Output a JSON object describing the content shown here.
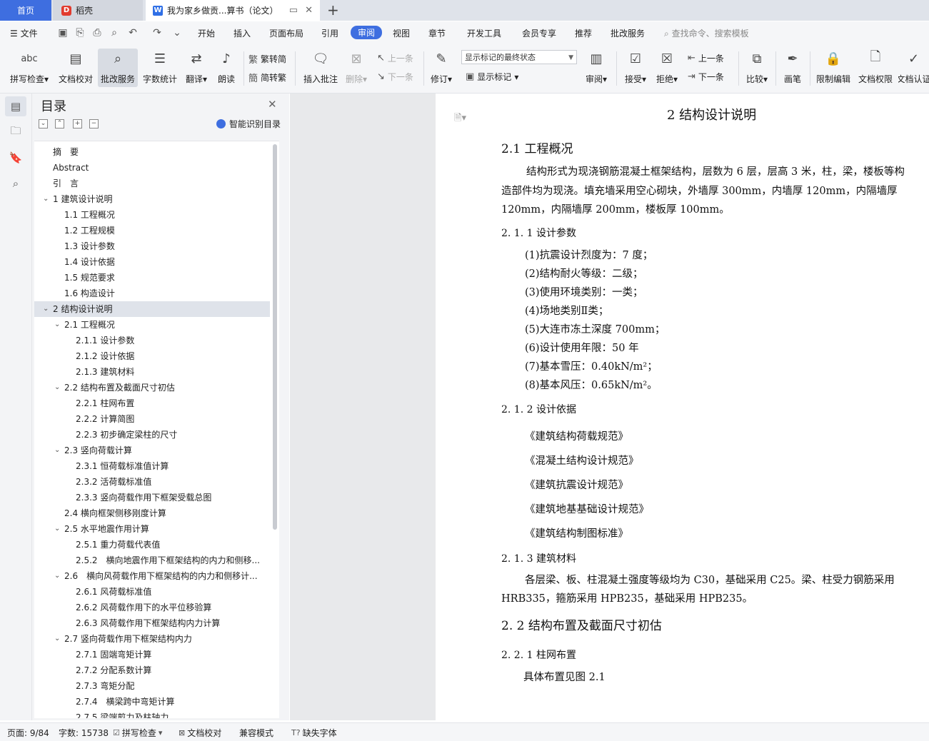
{
  "tabs": {
    "home": "首页",
    "daoke": "稻壳",
    "doc": "我为家乡做贡...算书（论文）"
  },
  "menu": {
    "file": "文件",
    "items": [
      "开始",
      "插入",
      "页面布局",
      "引用",
      "审阅",
      "视图",
      "章节",
      "开发工具",
      "会员专享",
      "推荐",
      "批改服务"
    ],
    "active": "审阅",
    "search": "查找命令、搜索模板"
  },
  "ribbon": {
    "spell": "拼写检查",
    "proofread": "文档校对",
    "correct": "批改服务",
    "wordcount": "字数统计",
    "translate": "翻译",
    "read": "朗读",
    "trad": "繁转简",
    "simp": "简转繁",
    "insert_comment": "插入批注",
    "delete": "删除",
    "prev": "上一条",
    "next": "下一条",
    "revise": "修订",
    "markup_state": "显示标记的最终状态",
    "show_markup": "显示标记",
    "review": "审阅",
    "accept": "接受",
    "reject": "拒绝",
    "prev2": "上一条",
    "next2": "下一条",
    "compare": "比较",
    "pen": "画笔",
    "restrict": "限制编辑",
    "permission": "文档权限",
    "cert": "文档认证"
  },
  "toc": {
    "title": "目录",
    "smart": "智能识别目录",
    "items": [
      {
        "label": "摘　要",
        "level": 0,
        "chev": false
      },
      {
        "label": "Abstract",
        "level": 0,
        "chev": false
      },
      {
        "label": "引　言",
        "level": 0,
        "chev": false
      },
      {
        "label": "1  建筑设计说明",
        "level": 0,
        "chev": true
      },
      {
        "label": "1.1  工程概况",
        "level": 1,
        "chev": false
      },
      {
        "label": "1.2  工程规模",
        "level": 1,
        "chev": false
      },
      {
        "label": "1.3  设计参数",
        "level": 1,
        "chev": false
      },
      {
        "label": "1.4  设计依据",
        "level": 1,
        "chev": false
      },
      {
        "label": "1.5  规范要求",
        "level": 1,
        "chev": false
      },
      {
        "label": "1.6  构造设计",
        "level": 1,
        "chev": false
      },
      {
        "label": "2  结构设计说明",
        "level": 0,
        "chev": true,
        "selected": true
      },
      {
        "label": "2.1  工程概况",
        "level": 1,
        "chev": true
      },
      {
        "label": "2.1.1 设计参数",
        "level": 2,
        "chev": false
      },
      {
        "label": "2.1.2  设计依据",
        "level": 2,
        "chev": false
      },
      {
        "label": "2.1.3  建筑材料",
        "level": 2,
        "chev": false
      },
      {
        "label": "2.2  结构布置及截面尺寸初估",
        "level": 1,
        "chev": true
      },
      {
        "label": "2.2.1  柱网布置",
        "level": 2,
        "chev": false
      },
      {
        "label": "2.2.2  计算简图",
        "level": 2,
        "chev": false
      },
      {
        "label": "2.2.3  初步确定梁柱的尺寸",
        "level": 2,
        "chev": false
      },
      {
        "label": "2.3  竖向荷载计算",
        "level": 1,
        "chev": true
      },
      {
        "label": "2.3.1  恒荷载标准值计算",
        "level": 2,
        "chev": false
      },
      {
        "label": "2.3.2  活荷载标准值",
        "level": 2,
        "chev": false
      },
      {
        "label": "2.3.3  竖向荷载作用下框架受载总图",
        "level": 2,
        "chev": false
      },
      {
        "label": "2.4  横向框架侧移刚度计算",
        "level": 1,
        "chev": false
      },
      {
        "label": "2.5  水平地震作用计算",
        "level": 1,
        "chev": true
      },
      {
        "label": "2.5.1  重力荷载代表值",
        "level": 2,
        "chev": false
      },
      {
        "label": "2.5.2　横向地震作用下框架结构的内力和侧移...",
        "level": 2,
        "chev": false
      },
      {
        "label": "2.6　横向风荷载作用下框架结构的内力和侧移计...",
        "level": 1,
        "chev": true
      },
      {
        "label": "2.6.1 风荷载标准值",
        "level": 2,
        "chev": false
      },
      {
        "label": "2.6.2  风荷载作用下的水平位移验算",
        "level": 2,
        "chev": false
      },
      {
        "label": "2.6.3 风荷载作用下框架结构内力计算",
        "level": 2,
        "chev": false
      },
      {
        "label": "2.7  竖向荷载作用下框架结构内力",
        "level": 1,
        "chev": true
      },
      {
        "label": "2.7.1  固端弯矩计算",
        "level": 2,
        "chev": false
      },
      {
        "label": "2.7.2  分配系数计算",
        "level": 2,
        "chev": false
      },
      {
        "label": "2.7.3  弯矩分配",
        "level": 2,
        "chev": false
      },
      {
        "label": "2.7.4　横梁跨中弯矩计算",
        "level": 2,
        "chev": false
      },
      {
        "label": "2.7.5  梁端剪力及柱轴力",
        "level": 2,
        "chev": false
      }
    ]
  },
  "doc": {
    "h1": "2  结构设计说明",
    "h2_1": "2.1  工程概况",
    "p1a": "结构形式为现浇钢筋混凝土框架结构，层数为 6 层，层高 3 米，柱，梁，楼板等构",
    "p1b": "造部件均为现浇。填充墙采用空心砌块，外墙厚 300mm，内墙厚 120mm，内隔墙厚",
    "p1c": "120mm，内隔墙厚 200mm，楼板厚 100mm。",
    "h3_1": "2. 1. 1 设计参数",
    "params": [
      "(1)抗震设计烈度为：7 度；",
      "(2)结构耐火等级：二级；",
      "(3)使用环境类别：一类；",
      "(4)场地类别Ⅱ类；",
      "(5)大连市冻土深度 700mm；",
      "(6)设计使用年限：50 年",
      "(7)基本雪压：0.40kN/m²；",
      "(8)基本风压：0.65kN/m²。"
    ],
    "h3_2": "2. 1. 2  设计依据",
    "codes": [
      "《建筑结构荷载规范》",
      "《混凝土结构设计规范》",
      "《建筑抗震设计规范》",
      "《建筑地基基础设计规范》",
      "《建筑结构制图标准》"
    ],
    "h3_3": "2. 1. 3  建筑材料",
    "p2a": "各层梁、板、柱混凝土强度等级均为 C30，基础采用 C25。梁、柱受力钢筋采用",
    "p2b": "HRB335，箍筋采用 HPB235，基础采用 HPB235。",
    "h2_2": "2. 2  结构布置及截面尺寸初估",
    "h3_4": "2. 2. 1  柱网布置",
    "p3": "具体布置见图 2.1"
  },
  "status": {
    "page": "页面: 9/84",
    "words": "字数: 15738",
    "spell": "拼写检查",
    "proof": "文档校对",
    "compat": "兼容模式",
    "font": "缺失字体"
  }
}
